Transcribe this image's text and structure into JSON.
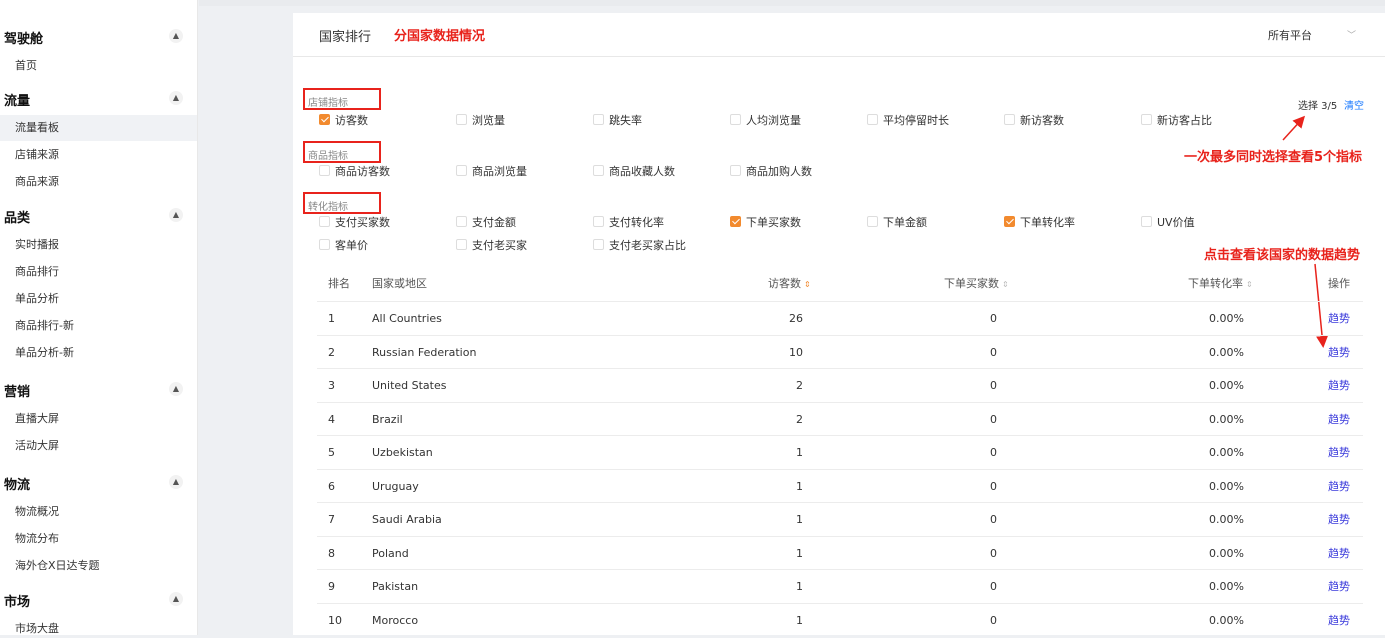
{
  "sidebar": {
    "sections": [
      {
        "title": "驾驶舱",
        "toggle": "▲",
        "items": [
          {
            "label": "首页",
            "active": false
          }
        ]
      },
      {
        "title": "流量",
        "toggle": "▲",
        "items": [
          {
            "label": "流量看板",
            "active": true
          },
          {
            "label": "店铺来源",
            "active": false
          },
          {
            "label": "商品来源",
            "active": false
          }
        ]
      },
      {
        "title": "品类",
        "toggle": "▲",
        "items": [
          {
            "label": "实时播报",
            "active": false
          },
          {
            "label": "商品排行",
            "active": false
          },
          {
            "label": "单品分析",
            "active": false
          },
          {
            "label": "商品排行-新",
            "active": false
          },
          {
            "label": "单品分析-新",
            "active": false
          }
        ]
      },
      {
        "title": "营销",
        "toggle": "▲",
        "items": [
          {
            "label": "直播大屏",
            "active": false
          },
          {
            "label": "活动大屏",
            "active": false
          }
        ]
      },
      {
        "title": "物流",
        "toggle": "▲",
        "items": [
          {
            "label": "物流概况",
            "active": false
          },
          {
            "label": "物流分布",
            "active": false
          },
          {
            "label": "海外仓X日达专题",
            "active": false
          }
        ]
      },
      {
        "title": "市场",
        "toggle": "▲",
        "items": [
          {
            "label": "市场大盘",
            "active": false
          }
        ]
      }
    ]
  },
  "header": {
    "title": "国家排行",
    "note": "分国家数据情况",
    "platform_label": "所有平台",
    "platform_arrow": "﹀"
  },
  "metrics": {
    "groups": [
      {
        "label": "店铺指标",
        "options": [
          {
            "label": "访客数",
            "checked": true
          },
          {
            "label": "浏览量",
            "checked": false
          },
          {
            "label": "跳失率",
            "checked": false
          },
          {
            "label": "人均浏览量",
            "checked": false
          },
          {
            "label": "平均停留时长",
            "checked": false
          },
          {
            "label": "新访客数",
            "checked": false
          },
          {
            "label": "新访客占比",
            "checked": false
          }
        ]
      },
      {
        "label": "商品指标",
        "options": [
          {
            "label": "商品访客数",
            "checked": false
          },
          {
            "label": "商品浏览量",
            "checked": false
          },
          {
            "label": "商品收藏人数",
            "checked": false
          },
          {
            "label": "商品加购人数",
            "checked": false
          }
        ]
      },
      {
        "label": "转化指标",
        "options": [
          {
            "label": "支付买家数",
            "checked": false
          },
          {
            "label": "支付金额",
            "checked": false
          },
          {
            "label": "支付转化率",
            "checked": false
          },
          {
            "label": "下单买家数",
            "checked": true
          },
          {
            "label": "下单金额",
            "checked": false
          },
          {
            "label": "下单转化率",
            "checked": true
          },
          {
            "label": "UV价值",
            "checked": false
          },
          {
            "label": "客单价",
            "checked": false
          },
          {
            "label": "支付老买家",
            "checked": false
          },
          {
            "label": "支付老买家占比",
            "checked": false
          }
        ]
      }
    ],
    "selection_count": "选择 3/5",
    "clear_label": "清空"
  },
  "annotations": {
    "max_select": "一次最多同时选择查看5个指标",
    "trend_tip": "点击查看该国家的数据趋势"
  },
  "table": {
    "columns": {
      "rank": "排名",
      "country": "国家或地区",
      "visitors": "访客数",
      "order_buyers": "下单买家数",
      "order_rate": "下单转化率",
      "action": "操作"
    },
    "sort_icon": "⇕",
    "rows": [
      {
        "rank": "1",
        "country": "All Countries",
        "visitors": "26",
        "order_buyers": "0",
        "order_rate": "0.00%",
        "action": "趋势"
      },
      {
        "rank": "2",
        "country": "Russian Federation",
        "visitors": "10",
        "order_buyers": "0",
        "order_rate": "0.00%",
        "action": "趋势"
      },
      {
        "rank": "3",
        "country": "United States",
        "visitors": "2",
        "order_buyers": "0",
        "order_rate": "0.00%",
        "action": "趋势"
      },
      {
        "rank": "4",
        "country": "Brazil",
        "visitors": "2",
        "order_buyers": "0",
        "order_rate": "0.00%",
        "action": "趋势"
      },
      {
        "rank": "5",
        "country": "Uzbekistan",
        "visitors": "1",
        "order_buyers": "0",
        "order_rate": "0.00%",
        "action": "趋势"
      },
      {
        "rank": "6",
        "country": "Uruguay",
        "visitors": "1",
        "order_buyers": "0",
        "order_rate": "0.00%",
        "action": "趋势"
      },
      {
        "rank": "7",
        "country": "Saudi Arabia",
        "visitors": "1",
        "order_buyers": "0",
        "order_rate": "0.00%",
        "action": "趋势"
      },
      {
        "rank": "8",
        "country": "Poland",
        "visitors": "1",
        "order_buyers": "0",
        "order_rate": "0.00%",
        "action": "趋势"
      },
      {
        "rank": "9",
        "country": "Pakistan",
        "visitors": "1",
        "order_buyers": "0",
        "order_rate": "0.00%",
        "action": "趋势"
      },
      {
        "rank": "10",
        "country": "Morocco",
        "visitors": "1",
        "order_buyers": "0",
        "order_rate": "0.00%",
        "action": "趋势"
      }
    ]
  },
  "colors": {
    "accent": "#f28a2e",
    "annotation_red": "#e8231c",
    "link_blue": "#1677ff",
    "trend_blue": "#3a3adb"
  }
}
